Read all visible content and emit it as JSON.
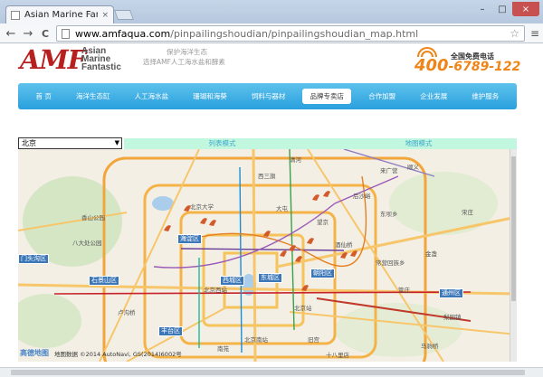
{
  "browser": {
    "tab_title": "Asian Marine Fantastic",
    "tab_close": "×",
    "url_domain": "www.amfaqua.com",
    "url_path": "/pinpailingshoudian/pinpailingshoudian_map.html",
    "back": "←",
    "forward": "→",
    "reload": "C",
    "star": "☆",
    "menu": "≡",
    "minimize": "–",
    "maximize": "□",
    "close": "×"
  },
  "header": {
    "logo_mark": "AMF",
    "logo_words": [
      "Asian",
      "Marine",
      "Fantastic"
    ],
    "slogan_lines": [
      "保护海洋生态",
      "选择AMF人工海水盐和酵素"
    ],
    "hotline_label": "全国免费电话",
    "hotline_prefix": "400",
    "hotline_number": "-6789-122"
  },
  "nav": {
    "items": [
      {
        "label": "首 页",
        "active": false
      },
      {
        "label": "海洋生态缸",
        "active": false
      },
      {
        "label": "人工海水盐",
        "active": false
      },
      {
        "label": "珊瑚和海葵",
        "active": false
      },
      {
        "label": "饲料与器材",
        "active": false
      },
      {
        "label": "品牌专卖店",
        "active": true
      },
      {
        "label": "合作加盟",
        "active": false
      },
      {
        "label": "企业发展",
        "active": false
      },
      {
        "label": "维护服务",
        "active": false
      }
    ]
  },
  "filter": {
    "city": "北京",
    "arrow": "▼",
    "tabs": [
      "列表模式",
      "地图模式"
    ]
  },
  "map": {
    "labels": [
      "清河",
      "昌平",
      "北京大学",
      "西三旗",
      "大屯",
      "望京",
      "酒仙桥",
      "后沙峪",
      "顺义",
      "北苑",
      "来广营",
      "东坝乡",
      "金盏",
      "管庄",
      "常营回族乡",
      "朝阳",
      "北京西站",
      "北京站",
      "老君堂",
      "龙潭",
      "王四营",
      "十八里店",
      "旧宫",
      "六环路",
      "香山公园",
      "八大处公园",
      "卢沟桥",
      "北京南站",
      "丰台",
      "南苑",
      "五里店",
      "枣林",
      "梨园镇",
      "宋庄",
      "马驹桥"
    ],
    "districts": [
      "海淀区",
      "门头沟区",
      "石景山区",
      "西城区",
      "东城区",
      "朝阳区",
      "通州区",
      "丰台区"
    ],
    "copyright": "地图数据 ©2014 AutoNavi, GS(2014)6002号",
    "logo": "高德地图"
  }
}
